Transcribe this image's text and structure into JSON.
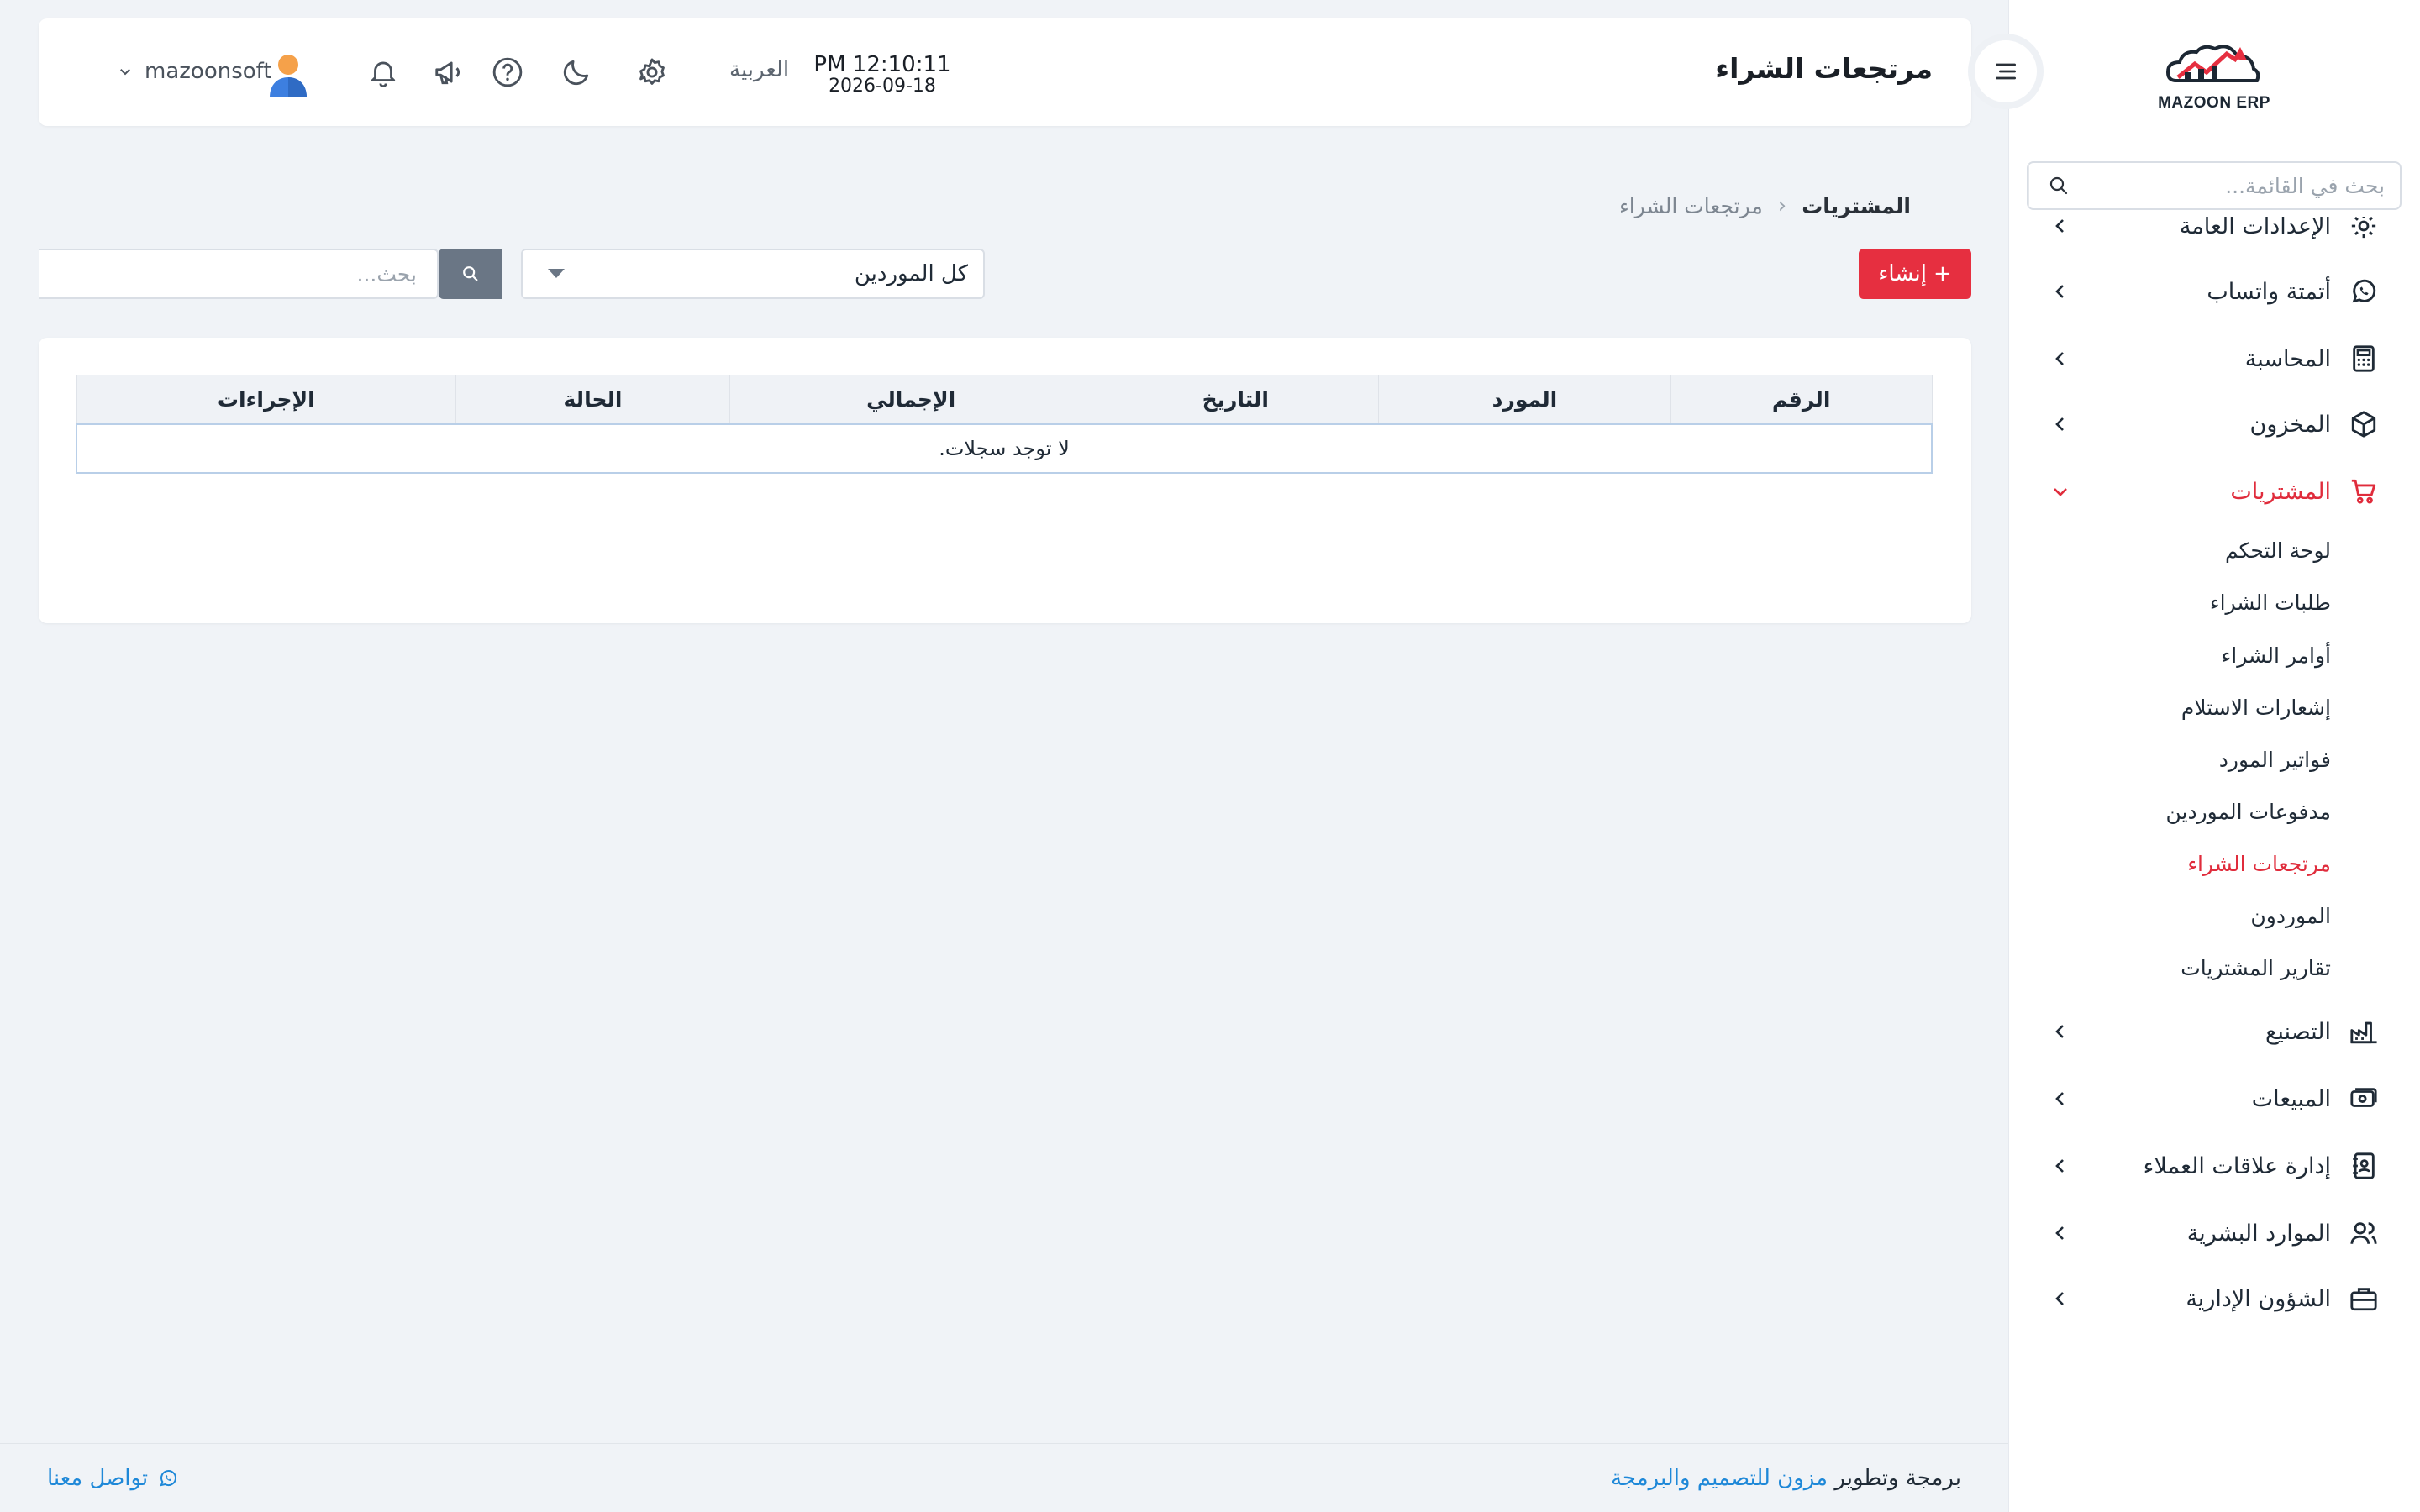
{
  "brand": {
    "name": "MAZOON ERP",
    "logo_caption": "ERP"
  },
  "sidebar": {
    "search_placeholder": "بحث في القائمة...",
    "items": [
      {
        "label": "الإعدادات العامة",
        "icon": "gear-icon"
      },
      {
        "label": "أتمتة واتساب",
        "icon": "whatsapp-icon"
      },
      {
        "label": "المحاسبة",
        "icon": "calculator-icon"
      },
      {
        "label": "المخزون",
        "icon": "box-icon"
      },
      {
        "label": "المشتريات",
        "icon": "cart-icon",
        "active": true
      },
      {
        "label": "التصنيع",
        "icon": "factory-icon"
      },
      {
        "label": "المبيعات",
        "icon": "money-icon"
      },
      {
        "label": "إدارة علاقات العملاء",
        "icon": "contacts-book-icon"
      },
      {
        "label": "الموارد البشرية",
        "icon": "users-icon"
      },
      {
        "label": "الشؤون الإدارية",
        "icon": "briefcase-icon"
      }
    ],
    "purchases_sub": [
      "لوحة التحكم",
      "طلبات الشراء",
      "أوامر الشراء",
      "إشعارات الاستلام",
      "فواتير المورد",
      "مدفوعات الموردين",
      "مرتجعات الشراء",
      "الموردون",
      "تقارير المشتريات"
    ]
  },
  "header": {
    "title": "مرتجعات الشراء",
    "time": "PM 12:10:11",
    "date": "2026-09-18",
    "language": "العربية",
    "username": "mazoonsoft"
  },
  "breadcrumb": {
    "root": "المشتريات",
    "current": "مرتجعات الشراء"
  },
  "toolbar": {
    "create_label": "إنشاء",
    "supplier_filter": "كل الموردين",
    "search_placeholder": "بحث..."
  },
  "table": {
    "columns": [
      "الرقم",
      "المورد",
      "التاريخ",
      "الإجمالي",
      "الحالة",
      "الإجراءات"
    ],
    "empty_message": "لا توجد سجلات."
  },
  "footer": {
    "credit_prefix": "برمجة وتطوير",
    "company": "مزون للتصميم والبرمجة",
    "contact": "تواصل معنا"
  },
  "colors": {
    "accent": "#e62f40",
    "link": "#1e88d8",
    "search_button": "#6a7685"
  }
}
